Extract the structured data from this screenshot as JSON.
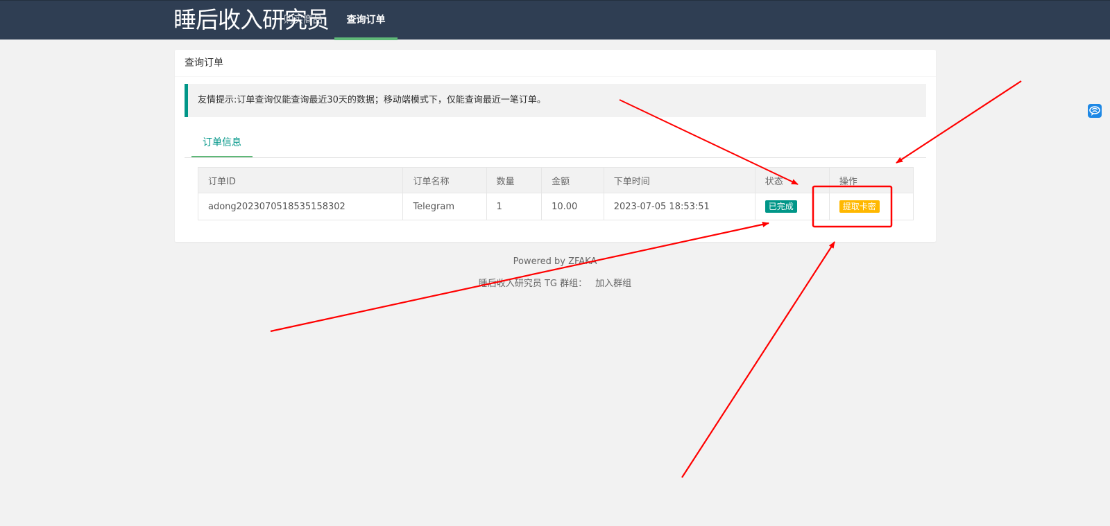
{
  "navbar": {
    "logo": "睡后收入研究员",
    "items": [
      {
        "label": "购买商品",
        "active": false
      },
      {
        "label": "查询订单",
        "active": true
      }
    ]
  },
  "card": {
    "title": "查询订单",
    "notice": "友情提示:订单查询仅能查询最近30天的数据；移动端模式下，仅能查询最近一笔订单。",
    "tab": "订单信息"
  },
  "table": {
    "headers": [
      "订单ID",
      "订单名称",
      "数量",
      "金额",
      "下单时间",
      "状态",
      "操作"
    ],
    "rows": [
      {
        "order_id": "adong2023070518535158302",
        "name": "Telegram",
        "qty": "1",
        "amount": "10.00",
        "time": "2023-07-05 18:53:51",
        "status": "已完成",
        "action": "提取卡密"
      }
    ]
  },
  "footer": {
    "powered": "Powered by ZFAKA",
    "group_text": "睡后收入研究员 TG 群组：",
    "join_link": "加入群组"
  },
  "colors": {
    "navbar": "#2f3e53",
    "accent": "#009688",
    "tab_underline": "#5fb878",
    "warn": "#ffb800",
    "annotation": "#ff0000"
  },
  "icons": {
    "side_widget": "chat-bubble-icon"
  }
}
